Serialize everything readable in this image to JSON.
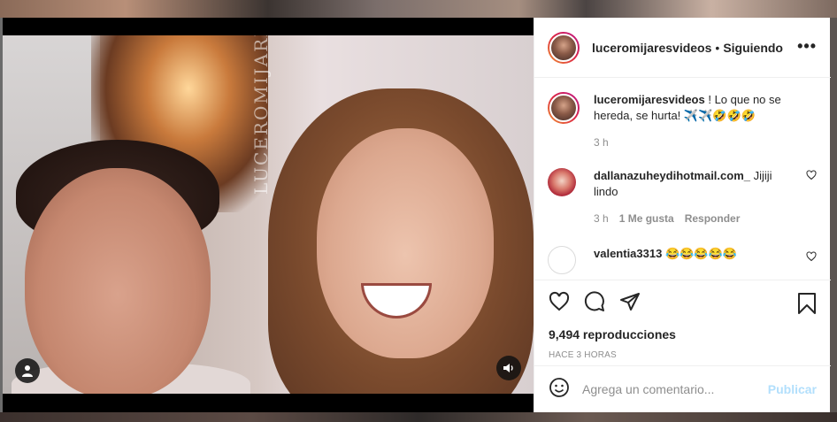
{
  "post": {
    "username": "luceromijaresvideos",
    "separator": "•",
    "follow_status": "Siguiendo",
    "more_icon": "more-options-icon",
    "watermark": "LUCEROMIJARESVIDEOS"
  },
  "caption": {
    "username": "luceromijaresvideos",
    "text": " ! Lo que no se hereda, se hurta! ✈️✈️🤣🤣🤣",
    "time": "3 h"
  },
  "comments": [
    {
      "username": "dallanazuheydihotmail.com_",
      "text": " Jijiji lindo",
      "time": "3 h",
      "likes": "1 Me gusta",
      "reply": "Responder"
    },
    {
      "username": "valentia3313",
      "text": " 😂😂😂😂😂"
    }
  ],
  "stats": {
    "views": "9,494 reproducciones",
    "posted": "HACE 3 HORAS"
  },
  "add_comment": {
    "placeholder": "Agrega un comentario...",
    "post_label": "Publicar"
  },
  "colors": {
    "post_button": "#b2dffc",
    "meta_text": "#8e8e8e",
    "primary_text": "#262626"
  }
}
